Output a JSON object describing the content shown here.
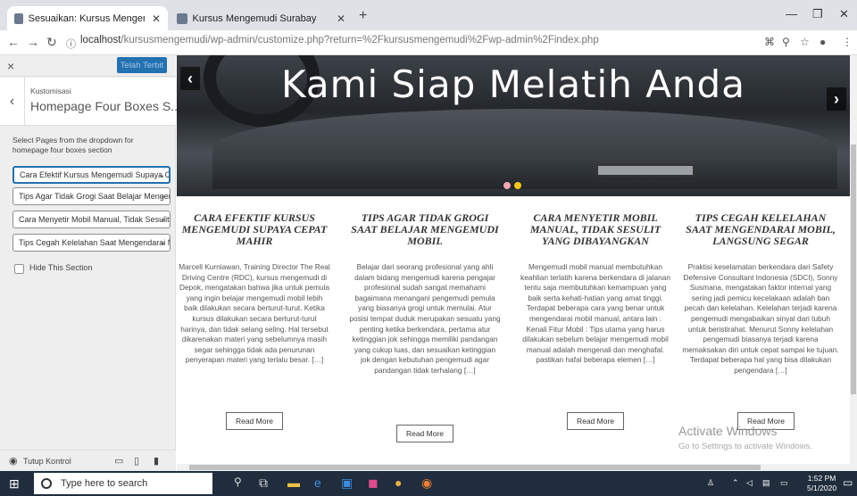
{
  "browser": {
    "tabs": [
      {
        "title": "Sesuaikan: Kursus Mengemudi S",
        "active": true
      },
      {
        "title": "Kursus Mengemudi Surabaya",
        "active": false
      }
    ],
    "new_tab": "+",
    "url_host": "localhost",
    "url_path": "/kursusmengemudi/wp-admin/customize.php?return=%2Fkursusmengemudi%2Fwp-admin%2Findex.php"
  },
  "sidebar": {
    "close": "×",
    "publish_label": "Telah Terbit",
    "back": "‹",
    "section_small": "Kustomisasi",
    "section_title": "Homepage Four Boxes S...",
    "description": "Select Pages from the dropdown for homepage four boxes section",
    "selects": [
      "Cara Efektif Kursus Mengemudi Supaya Cepat Mahir",
      "Tips Agar Tidak Grogi Saat Belajar Mengemudi Mobil",
      "Cara Menyetir Mobil Manual, Tidak Sesulit Yang Dibayangkan",
      "Tips Cegah Kelelahan Saat Mengendarai Mobil, Langsung Segar"
    ],
    "hide_label": "Hide This Section",
    "footer_label": "Tutup Kontrol"
  },
  "hero": {
    "title": "Kami Siap Melatih Anda",
    "prev": "‹",
    "next": "›"
  },
  "boxes": [
    {
      "title": "CARA EFEKTIF KURSUS MENGEMUDI SUPAYA CEPAT MAHIR",
      "body": "Marcell Kurniawan, Training Director The Real Driving Centre (RDC), kursus mengemudi di Depok, mengatakan bahwa jika untuk pemula yang ingin belajar mengemudi mobil lebih baik dilakukan secara berturut-turut. Ketika kursus dilakukan secara berturut-turut harinya, dan tidak selang seling. Hal tersebut dikarenakan materi yang sebelumnya masih segar sehingga tidak ada penurunan penyerapan materi yang terlalu besar. […]",
      "button": "Read More"
    },
    {
      "title": "TIPS AGAR TIDAK GROGI SAAT BELAJAR MENGEMUDI MOBIL",
      "body": "Belajar dari seorang profesional yang ahli dalam bidang mengemudi karena pengajar profesional sudah sangat memahami bagaimana menangani pengemudi pemula yang biasanya grogi untuk memulai. Atur posisi tempat duduk merupakan sesuatu yang penting ketika berkendara, pertama atur ketinggian jok sehingga memiliki pandangan yang cukup luas, dan sesuaikan ketinggian jok dengan kebutuhan pengemudi agar pandangan tidak terhalang […]",
      "button": "Read More"
    },
    {
      "title": "CARA MENYETIR MOBIL MANUAL, TIDAK SESULIT YANG DIBAYANGKAN",
      "body": "Mengemudi mobil manual membutuhkan keahlian terlatih karena berkendara di jalanan tentu saja membutuhkan kemampuan yang baik serta kehati-hatian yang amat tinggi. Terdapat beberapa cara yang benar untuk mengendarai mobil manual, antara lain : Kenali Fitur Mobil : Tips utama yang harus dilakukan sebelum belajar mengemudi mobil manual adalah mengenali dan menghafal. pastikan hafal beberapa elemen […]",
      "button": "Read More"
    },
    {
      "title": "TIPS CEGAH KELELAHAN SAAT MENGENDARAI MOBIL, LANGSUNG SEGAR",
      "body": "Praktisi keselamatan berkendara dari Safety Defensive Consultant Indonesia (SDCI), Sonny Susmana, mengatakan faktor internal yang sering jadi pemicu kecelakaan adalah ban pecah dan kelelahan. Kelelahan terjadi karena pengemudi mengabaikan sinyal dari tubuh untuk beristirahat. Menurut Sonny kelelahan pengemudi biasanya terjadi karena memaksakan diri untuk cepat sampai ke tujuan. Terdapat beberapa hal yang bisa dilakukan pengendara […]",
      "button": "Read More"
    }
  ],
  "watermark": {
    "line1": "Activate Windows",
    "line2": "Go to Settings to activate Windows."
  },
  "taskbar": {
    "search_placeholder": "Type here to search",
    "time": "1:52 PM",
    "date": "5/1/2020"
  },
  "colors": {
    "publish_bg": "#2271b1",
    "focus_border": "#2271b1",
    "taskbar_bg": "#1f2d3d",
    "dot_active": "#f5c518",
    "dot_inactive": "#f4a6b3"
  }
}
